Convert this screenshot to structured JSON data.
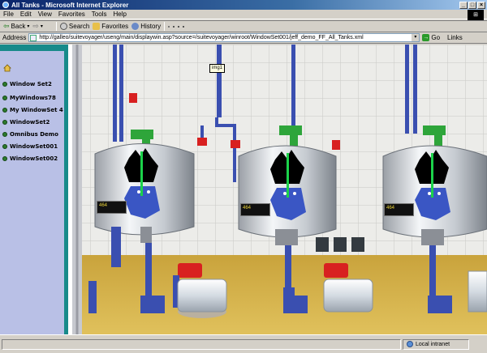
{
  "window": {
    "title": "All Tanks - Microsoft Internet Explorer"
  },
  "menu": {
    "items": [
      "File",
      "Edit",
      "View",
      "Favorites",
      "Tools",
      "Help"
    ]
  },
  "toolbar": {
    "back": "Back",
    "search": "Search",
    "favorites": "Favorites",
    "history": "History"
  },
  "address": {
    "label": "Address",
    "value": "http://galleo/suitevoyager/useng/main/displaywin.asp?source=/suitevoyager/winroot/WindowSet001/jeff_demo_FF_All_Tanks.xml",
    "go": "Go",
    "links": "Links"
  },
  "sidebar": {
    "items": [
      {
        "label": "Window Set2"
      },
      {
        "label": "MyWindows78"
      },
      {
        "label": "My WindowSet 4"
      },
      {
        "label": "WindowSet2"
      },
      {
        "label": "Omnibus Demo"
      },
      {
        "label": "WindowSet001"
      },
      {
        "label": "WindowSet002"
      }
    ]
  },
  "scene": {
    "tooltip": "img1",
    "tanks": [
      {
        "readout": "464"
      },
      {
        "readout": "464"
      },
      {
        "readout": "464"
      }
    ]
  },
  "status": {
    "zone": "Local intranet"
  },
  "colors": {
    "titlebar": "#0a246a",
    "sidebar_bg": "#b9c0e6",
    "sidebar_stripe": "#178a8a",
    "pipe": "#3a4fb0",
    "valve": "#d82020",
    "motor": "#2ea53a",
    "readout_bg": "#111111",
    "readout_text": "#e8d23a"
  }
}
